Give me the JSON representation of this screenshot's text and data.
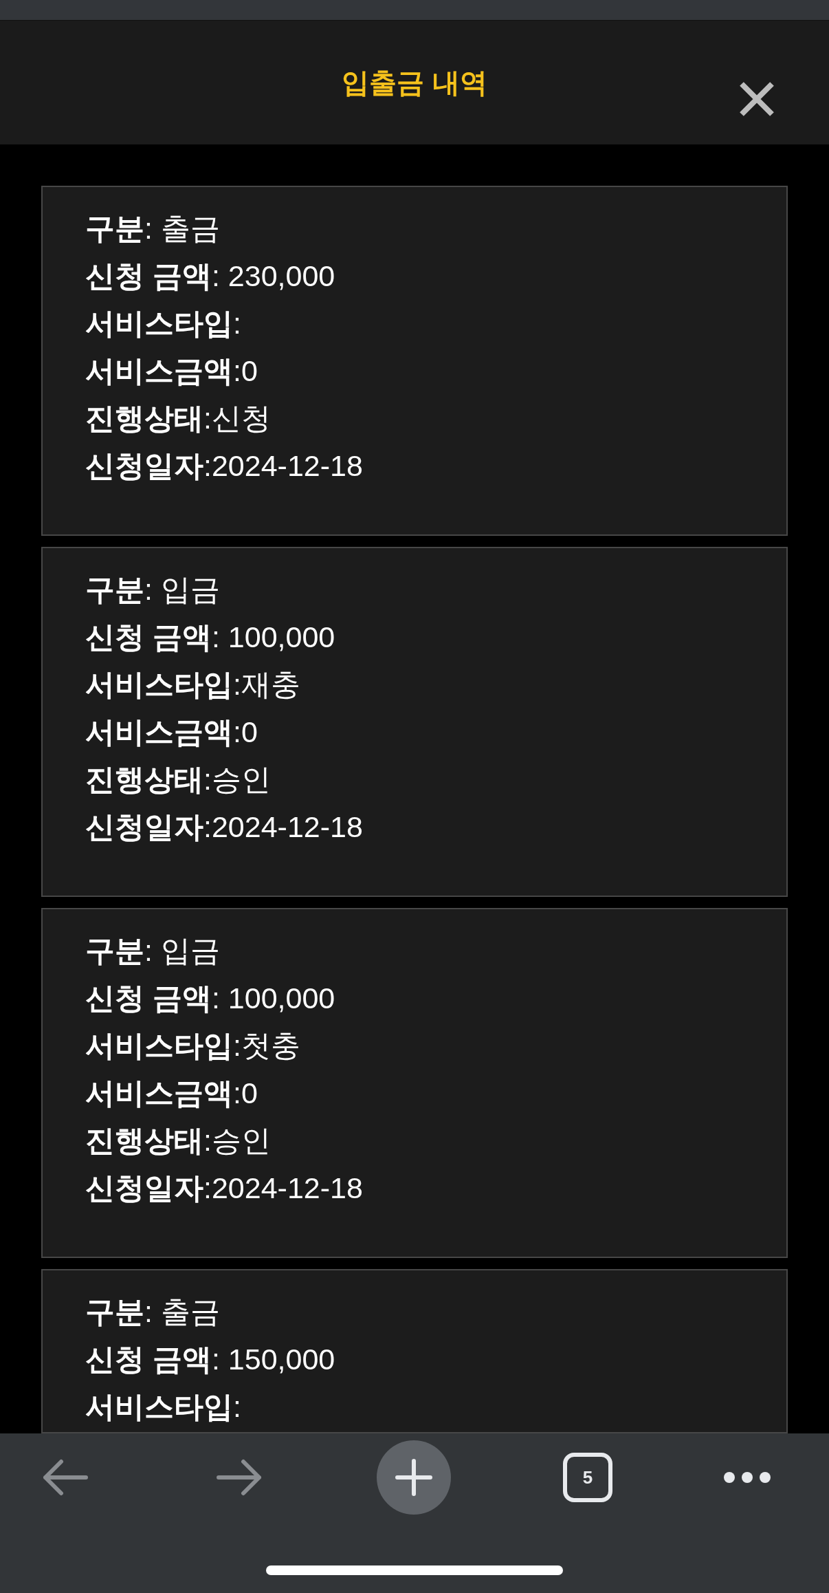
{
  "header": {
    "title": "입출금 내역"
  },
  "records": [
    {
      "fields": [
        {
          "label": "구분",
          "value": ": 출금"
        },
        {
          "label": "신청 금액",
          "value": ": 230,000"
        },
        {
          "label": "서비스타입",
          "value": ":"
        },
        {
          "label": "서비스금액",
          "value": ":0"
        },
        {
          "label": "진행상태",
          "value": ":신청"
        },
        {
          "label": "신청일자",
          "value": ":2024-12-18"
        }
      ]
    },
    {
      "fields": [
        {
          "label": "구분",
          "value": ": 입금"
        },
        {
          "label": "신청 금액",
          "value": ": 100,000"
        },
        {
          "label": "서비스타입",
          "value": ":재충"
        },
        {
          "label": "서비스금액",
          "value": ":0"
        },
        {
          "label": "진행상태",
          "value": ":승인"
        },
        {
          "label": "신청일자",
          "value": ":2024-12-18"
        }
      ]
    },
    {
      "fields": [
        {
          "label": "구분",
          "value": ": 입금"
        },
        {
          "label": "신청 금액",
          "value": ": 100,000"
        },
        {
          "label": "서비스타입",
          "value": ":첫충"
        },
        {
          "label": "서비스금액",
          "value": ":0"
        },
        {
          "label": "진행상태",
          "value": ":승인"
        },
        {
          "label": "신청일자",
          "value": ":2024-12-18"
        }
      ]
    },
    {
      "fields": [
        {
          "label": "구분",
          "value": ": 출금"
        },
        {
          "label": "신청 금액",
          "value": ": 150,000"
        },
        {
          "label": "서비스타입",
          "value": ":"
        }
      ]
    }
  ],
  "toolbar": {
    "buttons": [
      {
        "kind": "back",
        "disabled": true
      },
      {
        "kind": "forward",
        "disabled": true
      },
      {
        "kind": "new_tab"
      },
      {
        "kind": "tabs",
        "count": "5"
      },
      {
        "kind": "more"
      }
    ]
  }
}
